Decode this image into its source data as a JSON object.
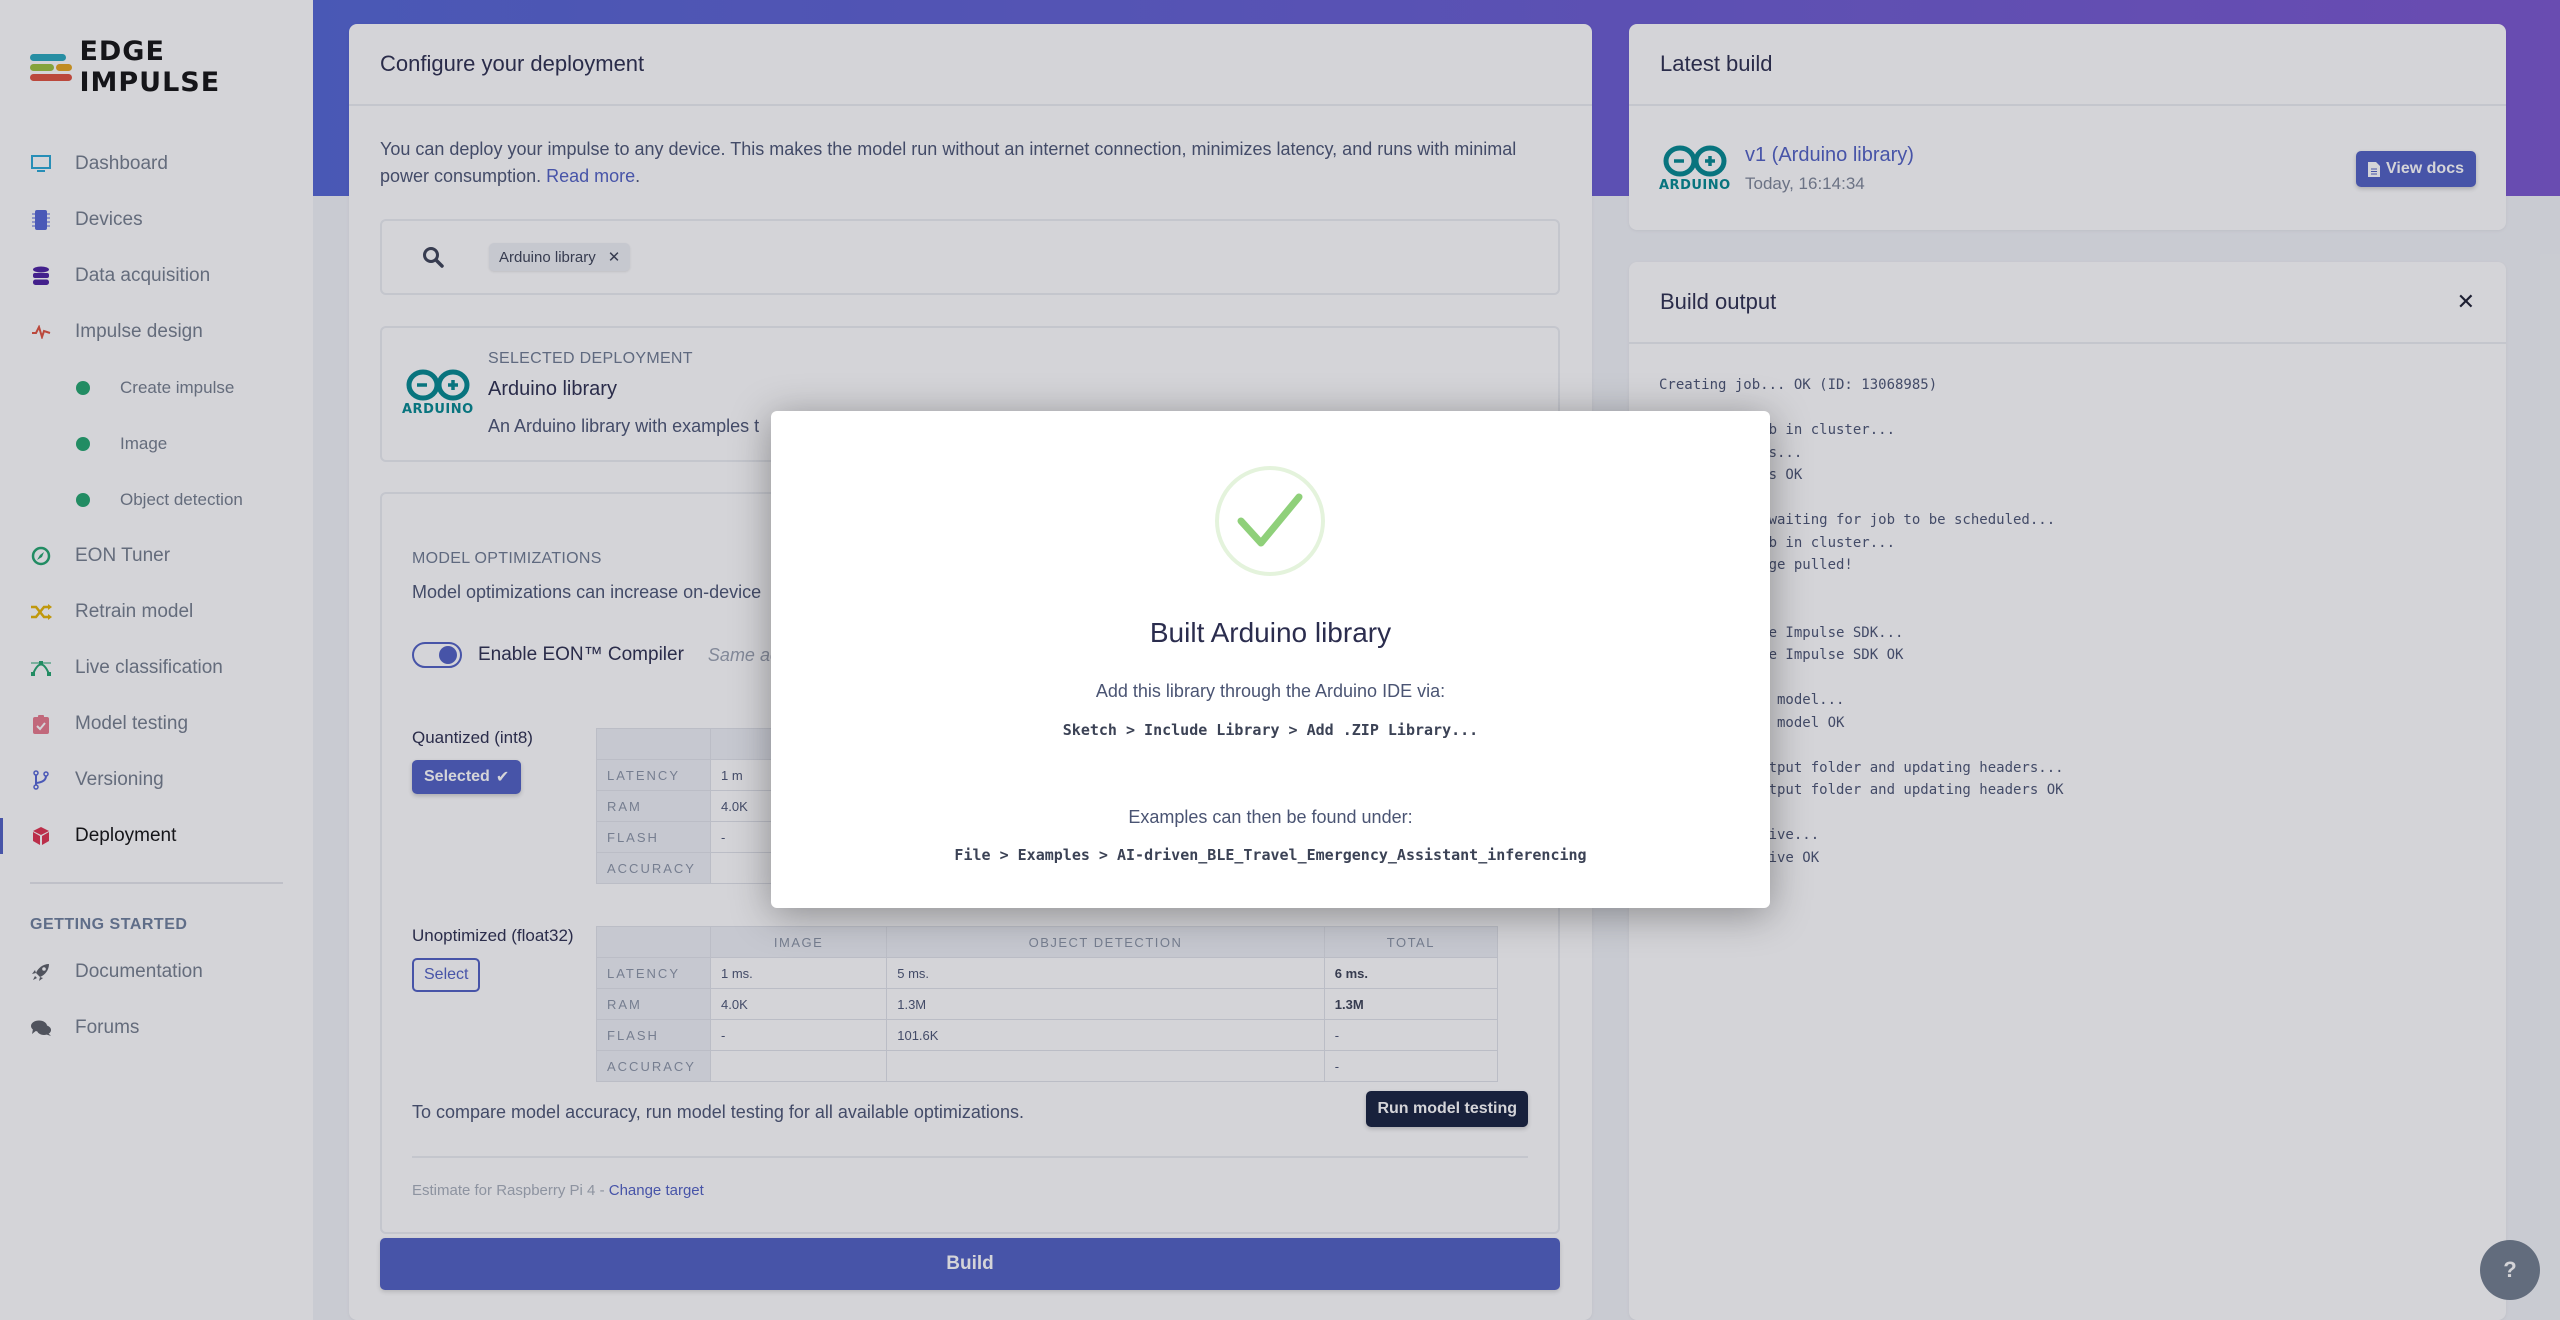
{
  "brand": {
    "name": "EDGE IMPULSE",
    "accent": "#4f5fc4"
  },
  "sidebar": {
    "items": [
      {
        "label": "Dashboard",
        "icon": "monitor-icon"
      },
      {
        "label": "Devices",
        "icon": "chip-icon"
      },
      {
        "label": "Data acquisition",
        "icon": "database-icon"
      },
      {
        "label": "Impulse design",
        "icon": "pulse-icon"
      },
      {
        "label": "Create impulse",
        "icon": "status-dot-icon",
        "sub": true
      },
      {
        "label": "Image",
        "icon": "status-dot-icon",
        "sub": true
      },
      {
        "label": "Object detection",
        "icon": "status-dot-icon",
        "sub": true
      },
      {
        "label": "EON Tuner",
        "icon": "compass-icon"
      },
      {
        "label": "Retrain model",
        "icon": "shuffle-icon"
      },
      {
        "label": "Live classification",
        "icon": "bezier-icon"
      },
      {
        "label": "Model testing",
        "icon": "clipboard-check-icon"
      },
      {
        "label": "Versioning",
        "icon": "branch-icon"
      },
      {
        "label": "Deployment",
        "icon": "cube-icon",
        "active": true
      }
    ],
    "section_heading": "GETTING STARTED",
    "footer_items": [
      {
        "label": "Documentation",
        "icon": "rocket-icon"
      },
      {
        "label": "Forums",
        "icon": "comments-icon"
      }
    ]
  },
  "configure": {
    "title": "Configure your deployment",
    "intro": "You can deploy your impulse to any device. This makes the model run without an internet connection, minimizes latency, and runs with minimal power consumption. ",
    "read_more": "Read more",
    "search_chip": "Arduino library",
    "selected": {
      "label": "SELECTED DEPLOYMENT",
      "title": "Arduino library",
      "description": "An Arduino library with examples t"
    },
    "optimizations": {
      "heading": "MODEL OPTIMIZATIONS",
      "description": "Model optimizations can increase on-device",
      "eon_label": "Enable EON™ Compiler",
      "eon_hint": "Same accu",
      "eon_enabled": true,
      "variants": [
        {
          "label": "Quantized (int8)",
          "button": "Selected",
          "selected": true,
          "columns": [
            "",
            "",
            "",
            ""
          ],
          "rows": [
            {
              "metric": "LATENCY",
              "image": "1 m",
              "od": "",
              "total": ""
            },
            {
              "metric": "RAM",
              "image": "4.0K",
              "od": "",
              "total": ""
            },
            {
              "metric": "FLASH",
              "image": "-",
              "od": "",
              "total": ""
            },
            {
              "metric": "ACCURACY",
              "image": "",
              "od": "",
              "total": ""
            }
          ]
        },
        {
          "label": "Unoptimized (float32)",
          "button": "Select",
          "selected": false,
          "columns": [
            "",
            "IMAGE",
            "OBJECT DETECTION",
            "TOTAL"
          ],
          "rows": [
            {
              "metric": "LATENCY",
              "image": "1 ms.",
              "od": "5 ms.",
              "total": "6 ms."
            },
            {
              "metric": "RAM",
              "image": "4.0K",
              "od": "1.3M",
              "total": "1.3M"
            },
            {
              "metric": "FLASH",
              "image": "-",
              "od": "101.6K",
              "total": "-"
            },
            {
              "metric": "ACCURACY",
              "image": "",
              "od": "",
              "total": "-"
            }
          ]
        }
      ],
      "compare_text": "To compare model accuracy, run model testing for all available optimizations.",
      "run_testing": "Run model testing",
      "estimate_text": "Estimate for Raspberry Pi 4 - ",
      "change_target": "Change target"
    },
    "build_button": "Build"
  },
  "latest_build": {
    "title": "Latest build",
    "build_name": "v1 (Arduino library)",
    "build_time": "Today, 16:14:34",
    "view_docs": "View docs",
    "logo_word": "ARDUINO"
  },
  "build_output": {
    "title": "Build output",
    "close": "✕",
    "log": "Creating job... OK (ID: 13068985)\n\nScheduling job in cluster...\nPulling images...\nPulling images OK\n\nJob started, waiting for job to be scheduled...\nScheduling job in cluster...\nContainer image pulled!\n\n\nExporting Edge Impulse SDK...\nExporting Edge Impulse SDK OK\n\nCompiling EON model...\nCompiling EON model OK\n\nCopying to output folder and updating headers...\nCopying to output folder and updating headers OK\n\nCreating archive...\nCreating archive OK"
  },
  "modal": {
    "title": "Built Arduino library",
    "add_text": "Add this library through the Arduino IDE via:",
    "add_path": "Sketch > Include Library > Add .ZIP Library...",
    "examples_text": "Examples can then be found under:",
    "examples_path": "File > Examples > AI-driven_BLE_Travel_Emergency_Assistant_inferencing",
    "success_color": "#8fd07a"
  },
  "help": {
    "label": "?"
  }
}
